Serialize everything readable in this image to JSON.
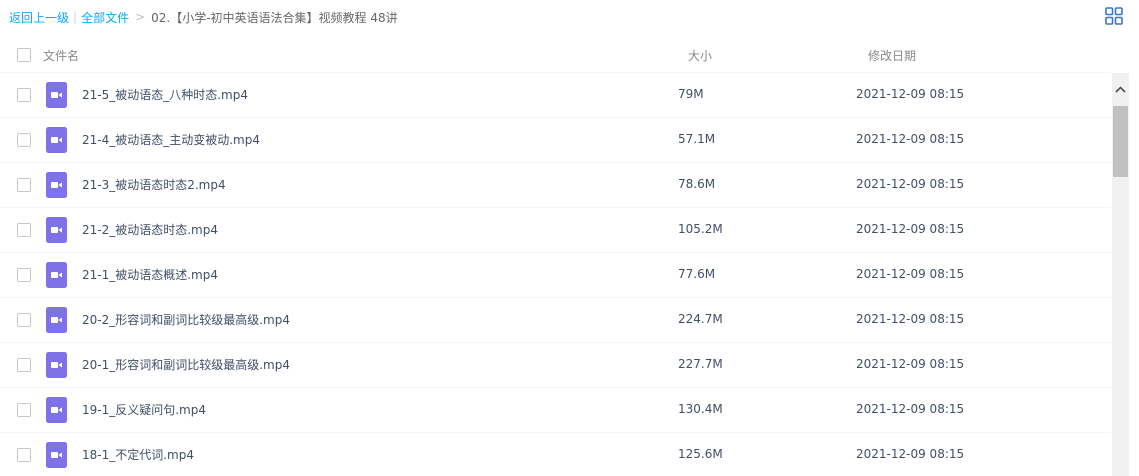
{
  "breadcrumb": {
    "back": "返回上一级",
    "sep1": "|",
    "all_files": "全部文件",
    "sep2": ">",
    "current": "02.【小学-初中英语语法合集】视频教程 48讲"
  },
  "header": {
    "name": "文件名",
    "size": "大小",
    "modified": "修改日期"
  },
  "colors": {
    "link": "#09aaff",
    "video_icon": "#7e72e8",
    "text": "#424e67"
  },
  "files": [
    {
      "name": "21-5_被动语态_八种时态.mp4",
      "size": "79M",
      "modified": "2021-12-09 08:15",
      "icon": "video-file-icon"
    },
    {
      "name": "21-4_被动语态_主动变被动.mp4",
      "size": "57.1M",
      "modified": "2021-12-09 08:15",
      "icon": "video-file-icon"
    },
    {
      "name": "21-3_被动语态时态2.mp4",
      "size": "78.6M",
      "modified": "2021-12-09 08:15",
      "icon": "video-file-icon"
    },
    {
      "name": "21-2_被动语态时态.mp4",
      "size": "105.2M",
      "modified": "2021-12-09 08:15",
      "icon": "video-file-icon"
    },
    {
      "name": "21-1_被动语态概述.mp4",
      "size": "77.6M",
      "modified": "2021-12-09 08:15",
      "icon": "video-file-icon"
    },
    {
      "name": "20-2_形容词和副词比较级最高级.mp4",
      "size": "224.7M",
      "modified": "2021-12-09 08:15",
      "icon": "video-file-icon"
    },
    {
      "name": "20-1_形容词和副词比较级最高级.mp4",
      "size": "227.7M",
      "modified": "2021-12-09 08:15",
      "icon": "video-file-icon"
    },
    {
      "name": "19-1_反义疑问句.mp4",
      "size": "130.4M",
      "modified": "2021-12-09 08:15",
      "icon": "video-file-icon"
    },
    {
      "name": "18-1_不定代词.mp4",
      "size": "125.6M",
      "modified": "2021-12-09 08:15",
      "icon": "video-file-icon"
    }
  ]
}
